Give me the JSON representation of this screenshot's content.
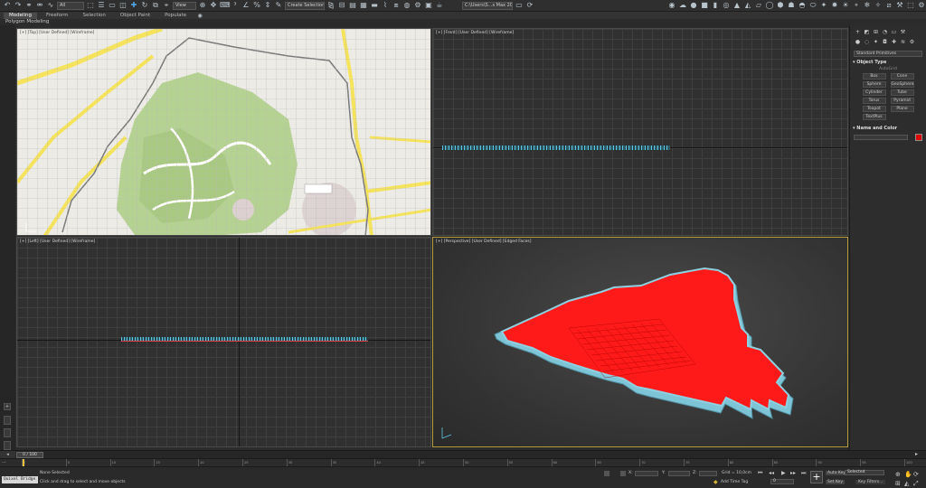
{
  "toolbar": {
    "selection_filter": "All",
    "view_dropdown": "View",
    "selection_set": "Create Selection Se",
    "workspace": "C:\\Users\\S...s Max 2020"
  },
  "ribbon": {
    "tabs": [
      "Modeling",
      "Freeform",
      "Selection",
      "Object Paint",
      "Populate"
    ],
    "active_tab": "Modeling",
    "subtitle": "Polygon Modeling"
  },
  "viewports": {
    "top_left": {
      "label": "[+] [Top] [User Defined] [Wireframe]"
    },
    "top_right": {
      "label": "[+] [Front] [User Defined] [Wireframe]"
    },
    "bottom_left": {
      "label": "[+] [Left] [User Defined] [Wireframe]"
    },
    "bottom_right": {
      "label": "[+] [Perspective] [User Defined] [Edged Faces]"
    }
  },
  "command_panel": {
    "category": "Standard Primitives",
    "object_type_title": "Object Type",
    "autogrid": "AutoGrid",
    "buttons": [
      "Box",
      "Cone",
      "Sphere",
      "GeoSphere",
      "Cylinder",
      "Tube",
      "Torus",
      "Pyramid",
      "Teapot",
      "Plane",
      "TextPlus"
    ],
    "name_color_title": "Name and Color",
    "object_color": "#e00000"
  },
  "timeline": {
    "frame_label": "0 / 100",
    "ticks": [
      "0",
      "5",
      "10",
      "15",
      "20",
      "25",
      "30",
      "35",
      "40",
      "45",
      "50",
      "55",
      "60",
      "65",
      "70",
      "75",
      "80",
      "85",
      "90",
      "95",
      "100"
    ]
  },
  "status": {
    "maxscript": "Quixel Bridge",
    "selection": "None Selected",
    "prompt": "Click and drag to select and move objects",
    "x_label": "X:",
    "y_label": "Y:",
    "z_label": "Z:",
    "grid": "Grid = 10,0cm",
    "add_time_tag": "Add Time Tag",
    "auto_key": "Auto Key",
    "set_key": "Set Key",
    "selected": "Selected",
    "key_filters": "Key Filters...",
    "frame_value": "0"
  },
  "map": {
    "colors": {
      "background": "#ecebe6",
      "park": "#b6d292",
      "road": "#f5e35c",
      "boundary": "#7a7a7a"
    }
  }
}
